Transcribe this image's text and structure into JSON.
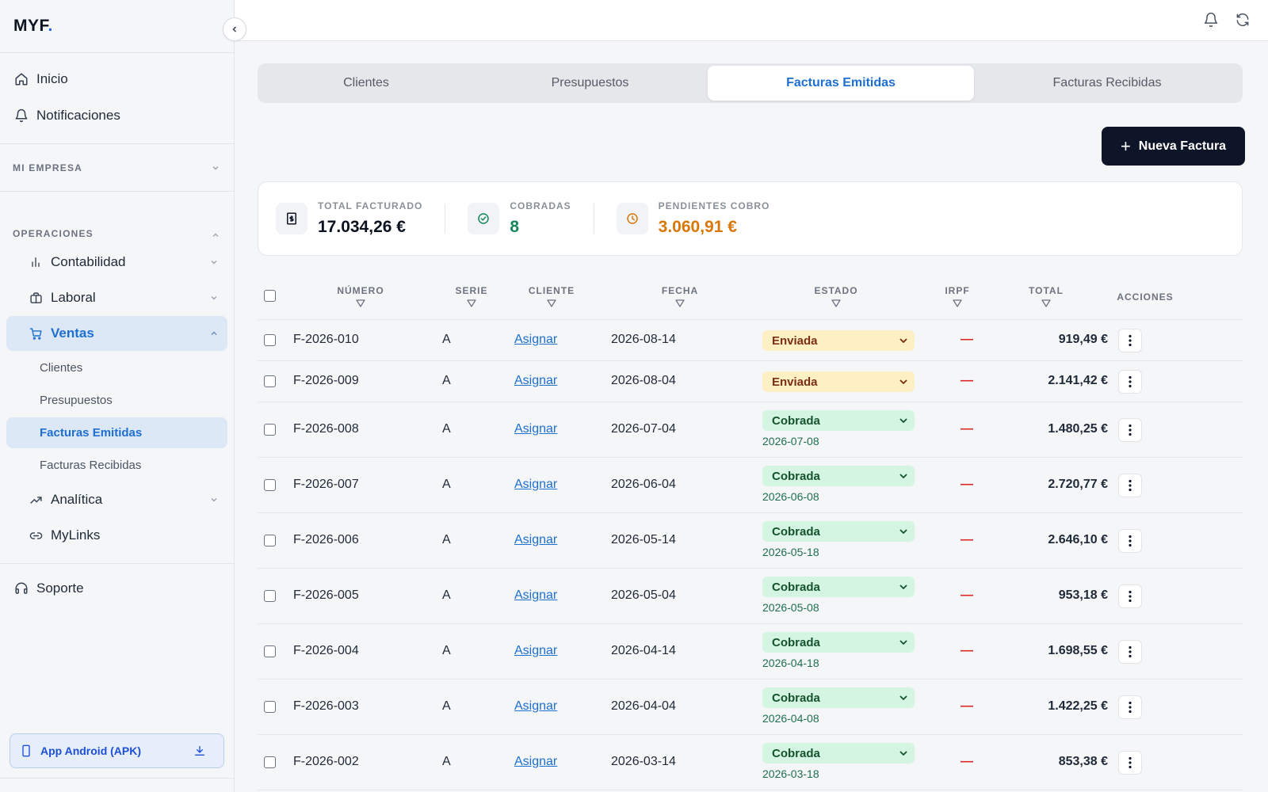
{
  "brand": {
    "logo_text": "MYF",
    "logo_dot": "."
  },
  "sidebar": {
    "top_items": [
      {
        "label": "Inicio",
        "icon": "home-icon"
      },
      {
        "label": "Notificaciones",
        "icon": "bell-icon"
      }
    ],
    "section_empresa": "MI EMPRESA",
    "section_operaciones": "OPERACIONES",
    "operaciones_items": [
      {
        "label": "Contabilidad",
        "icon": "bar-chart-icon"
      },
      {
        "label": "Laboral",
        "icon": "briefcase-icon"
      },
      {
        "label": "Ventas",
        "icon": "cart-icon"
      }
    ],
    "ventas_sub": [
      {
        "label": "Clientes"
      },
      {
        "label": "Presupuestos"
      },
      {
        "label": "Facturas Emitidas"
      },
      {
        "label": "Facturas Recibidas"
      }
    ],
    "more_items": [
      {
        "label": "Analítica",
        "icon": "trending-up-icon"
      },
      {
        "label": "MyLinks",
        "icon": "link-icon"
      }
    ],
    "support": "Soporte",
    "apk_button": "App Android (APK)"
  },
  "tabs": [
    "Clientes",
    "Presupuestos",
    "Facturas Emitidas",
    "Facturas Recibidas"
  ],
  "active_tab": "Facturas Emitidas",
  "new_button": "Nueva Factura",
  "stats": {
    "total_label": "TOTAL FACTURADO",
    "total_value": "17.034,26 €",
    "cobradas_label": "COBRADAS",
    "cobradas_value": "8",
    "pendientes_label": "PENDIENTES COBRO",
    "pendientes_value": "3.060,91 €"
  },
  "table": {
    "headers": {
      "numero": "NÚMERO",
      "serie": "SERIE",
      "cliente": "CLIENTE",
      "fecha": "FECHA",
      "estado": "ESTADO",
      "irpf": "IRPF",
      "total": "TOTAL",
      "acciones": "ACCIONES"
    },
    "rows": [
      {
        "numero": "F-2026-010",
        "serie": "A",
        "cliente": "Asignar",
        "fecha": "2026-08-14",
        "estado": "Enviada",
        "paid_date": "",
        "irpf": "—",
        "total": "919,49 €"
      },
      {
        "numero": "F-2026-009",
        "serie": "A",
        "cliente": "Asignar",
        "fecha": "2026-08-04",
        "estado": "Enviada",
        "paid_date": "",
        "irpf": "—",
        "total": "2.141,42 €"
      },
      {
        "numero": "F-2026-008",
        "serie": "A",
        "cliente": "Asignar",
        "fecha": "2026-07-04",
        "estado": "Cobrada",
        "paid_date": "2026-07-08",
        "irpf": "—",
        "total": "1.480,25 €"
      },
      {
        "numero": "F-2026-007",
        "serie": "A",
        "cliente": "Asignar",
        "fecha": "2026-06-04",
        "estado": "Cobrada",
        "paid_date": "2026-06-08",
        "irpf": "—",
        "total": "2.720,77 €"
      },
      {
        "numero": "F-2026-006",
        "serie": "A",
        "cliente": "Asignar",
        "fecha": "2026-05-14",
        "estado": "Cobrada",
        "paid_date": "2026-05-18",
        "irpf": "—",
        "total": "2.646,10 €"
      },
      {
        "numero": "F-2026-005",
        "serie": "A",
        "cliente": "Asignar",
        "fecha": "2026-05-04",
        "estado": "Cobrada",
        "paid_date": "2026-05-08",
        "irpf": "—",
        "total": "953,18 €"
      },
      {
        "numero": "F-2026-004",
        "serie": "A",
        "cliente": "Asignar",
        "fecha": "2026-04-14",
        "estado": "Cobrada",
        "paid_date": "2026-04-18",
        "irpf": "—",
        "total": "1.698,55 €"
      },
      {
        "numero": "F-2026-003",
        "serie": "A",
        "cliente": "Asignar",
        "fecha": "2026-04-04",
        "estado": "Cobrada",
        "paid_date": "2026-04-08",
        "irpf": "—",
        "total": "1.422,25 €"
      },
      {
        "numero": "F-2026-002",
        "serie": "A",
        "cliente": "Asignar",
        "fecha": "2026-03-14",
        "estado": "Cobrada",
        "paid_date": "2026-03-18",
        "irpf": "—",
        "total": "853,38 €"
      }
    ]
  },
  "colors": {
    "accent": "#1d6fd1",
    "primary_dark": "#0e1528",
    "enviada_bg": "#fdf0c4",
    "cobrada_bg": "#d4f5e2",
    "irpf_dash": "#dc2626",
    "cobradas_value": "#16875a",
    "pendientes_value": "#d97706"
  }
}
